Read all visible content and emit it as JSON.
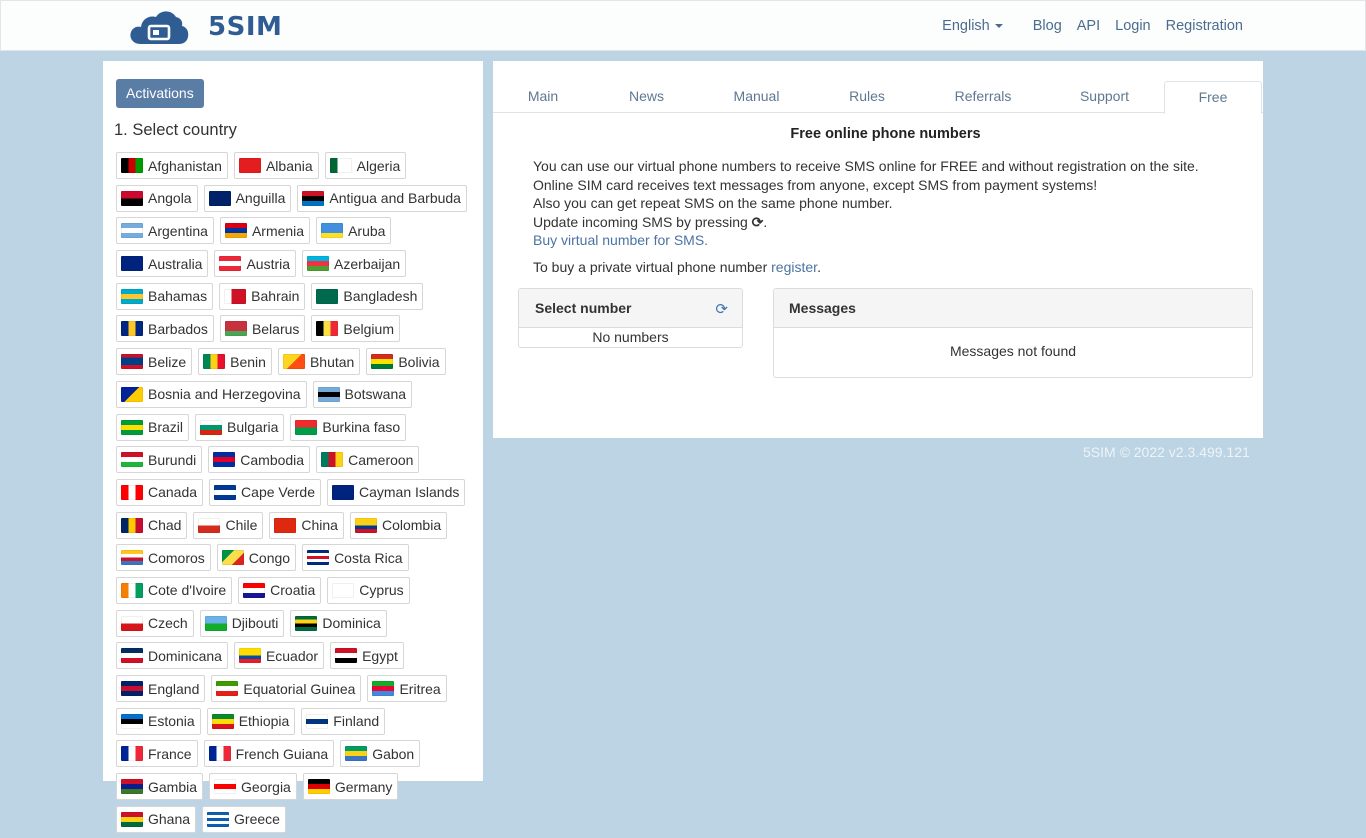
{
  "navbar": {
    "brand": "5SIM",
    "language": "English",
    "links": [
      "Blog",
      "API",
      "Login",
      "Registration"
    ]
  },
  "left": {
    "activations_button": "Activations",
    "select_title": "1. Select country",
    "countries": [
      {
        "name": "Afghanistan",
        "flag": [
          "#000",
          "#c00",
          "#090"
        ],
        "dir": "v"
      },
      {
        "name": "Albania",
        "flag": [
          "#e41e20",
          "#e41e20",
          "#e41e20"
        ],
        "dir": "v"
      },
      {
        "name": "Algeria",
        "flag": [
          "#006633",
          "#fff",
          "#fff"
        ],
        "dir": "v"
      },
      {
        "name": "Angola",
        "flag": [
          "#cc092f",
          "#000"
        ],
        "dir": "h"
      },
      {
        "name": "Anguilla",
        "flag": [
          "#012169",
          "#012169"
        ],
        "dir": "h"
      },
      {
        "name": "Antigua and Barbuda",
        "flag": [
          "#ce1126",
          "#000",
          "#0072c6"
        ],
        "dir": "h"
      },
      {
        "name": "Argentina",
        "flag": [
          "#74acdf",
          "#fff",
          "#74acdf"
        ],
        "dir": "h"
      },
      {
        "name": "Armenia",
        "flag": [
          "#d90012",
          "#0033a0",
          "#f2a800"
        ],
        "dir": "h"
      },
      {
        "name": "Aruba",
        "flag": [
          "#418fde",
          "#418fde",
          "#fbe122"
        ],
        "dir": "h"
      },
      {
        "name": "Australia",
        "flag": [
          "#00247d",
          "#00247d"
        ],
        "dir": "h"
      },
      {
        "name": "Austria",
        "flag": [
          "#ed2939",
          "#fff",
          "#ed2939"
        ],
        "dir": "h"
      },
      {
        "name": "Azerbaijan",
        "flag": [
          "#00b5e2",
          "#ef3340",
          "#509e2f"
        ],
        "dir": "h"
      },
      {
        "name": "Bahamas",
        "flag": [
          "#00abc9",
          "#ffc72c",
          "#00abc9"
        ],
        "dir": "h"
      },
      {
        "name": "Bahrain",
        "flag": [
          "#fff",
          "#ce1126",
          "#ce1126"
        ],
        "dir": "v"
      },
      {
        "name": "Bangladesh",
        "flag": [
          "#006a4e",
          "#006a4e"
        ],
        "dir": "h"
      },
      {
        "name": "Barbados",
        "flag": [
          "#00267f",
          "#ffc726",
          "#00267f"
        ],
        "dir": "v"
      },
      {
        "name": "Belarus",
        "flag": [
          "#c8313e",
          "#c8313e",
          "#4aa657"
        ],
        "dir": "h"
      },
      {
        "name": "Belgium",
        "flag": [
          "#000",
          "#fae042",
          "#ed2939"
        ],
        "dir": "v"
      },
      {
        "name": "Belize",
        "flag": [
          "#ce1126",
          "#003f87",
          "#003f87",
          "#ce1126"
        ],
        "dir": "h"
      },
      {
        "name": "Benin",
        "flag": [
          "#008751",
          "#fcd116",
          "#e8112d"
        ],
        "dir": "v"
      },
      {
        "name": "Bhutan",
        "flag": [
          "#ffd520",
          "#ff4e12"
        ],
        "dir": "d"
      },
      {
        "name": "Bolivia",
        "flag": [
          "#d52b1e",
          "#f9e300",
          "#007934"
        ],
        "dir": "h"
      },
      {
        "name": "Bosnia and Herzegovina",
        "flag": [
          "#002395",
          "#fecb00"
        ],
        "dir": "d"
      },
      {
        "name": "Botswana",
        "flag": [
          "#75aadb",
          "#000",
          "#75aadb"
        ],
        "dir": "h"
      },
      {
        "name": "Brazil",
        "flag": [
          "#009c3b",
          "#ffdf00",
          "#009c3b"
        ],
        "dir": "h"
      },
      {
        "name": "Bulgaria",
        "flag": [
          "#fff",
          "#00966e",
          "#d62612"
        ],
        "dir": "h"
      },
      {
        "name": "Burkina faso",
        "flag": [
          "#ef2b2d",
          "#009e49"
        ],
        "dir": "h"
      },
      {
        "name": "Burundi",
        "flag": [
          "#ce1126",
          "#fff",
          "#1eb53a"
        ],
        "dir": "h"
      },
      {
        "name": "Cambodia",
        "flag": [
          "#032ea1",
          "#e00025",
          "#032ea1"
        ],
        "dir": "h"
      },
      {
        "name": "Cameroon",
        "flag": [
          "#007a5e",
          "#ce1126",
          "#fcd116"
        ],
        "dir": "v"
      },
      {
        "name": "Canada",
        "flag": [
          "#ff0000",
          "#fff",
          "#ff0000"
        ],
        "dir": "v"
      },
      {
        "name": "Cape Verde",
        "flag": [
          "#003893",
          "#fff",
          "#003893"
        ],
        "dir": "h"
      },
      {
        "name": "Cayman Islands",
        "flag": [
          "#00247d",
          "#00247d"
        ],
        "dir": "h"
      },
      {
        "name": "Chad",
        "flag": [
          "#002664",
          "#fecb00",
          "#c60c30"
        ],
        "dir": "v"
      },
      {
        "name": "Chile",
        "flag": [
          "#fff",
          "#d52b1e"
        ],
        "dir": "h"
      },
      {
        "name": "China",
        "flag": [
          "#de2910",
          "#de2910"
        ],
        "dir": "h"
      },
      {
        "name": "Colombia",
        "flag": [
          "#fcd116",
          "#fcd116",
          "#003893",
          "#ce1126"
        ],
        "dir": "h"
      },
      {
        "name": "Comoros",
        "flag": [
          "#ffc61e",
          "#fff",
          "#ce1126",
          "#3a75c4"
        ],
        "dir": "h"
      },
      {
        "name": "Congo",
        "flag": [
          "#009543",
          "#fbde4a",
          "#dc241f"
        ],
        "dir": "d"
      },
      {
        "name": "Costa Rica",
        "flag": [
          "#002b7f",
          "#fff",
          "#ce1126",
          "#fff",
          "#002b7f"
        ],
        "dir": "h"
      },
      {
        "name": "Cote d'Ivoire",
        "flag": [
          "#f77f00",
          "#fff",
          "#009e60"
        ],
        "dir": "v"
      },
      {
        "name": "Croatia",
        "flag": [
          "#ff0000",
          "#fff",
          "#171796"
        ],
        "dir": "h"
      },
      {
        "name": "Cyprus",
        "flag": [
          "#fff",
          "#fff"
        ],
        "dir": "h"
      },
      {
        "name": "Czech",
        "flag": [
          "#fff",
          "#d7141a"
        ],
        "dir": "h"
      },
      {
        "name": "Djibouti",
        "flag": [
          "#6ab2e7",
          "#12ad2b"
        ],
        "dir": "h"
      },
      {
        "name": "Dominica",
        "flag": [
          "#006b3f",
          "#fcd116",
          "#000",
          "#006b3f"
        ],
        "dir": "h"
      },
      {
        "name": "Dominicana",
        "flag": [
          "#002d62",
          "#fff",
          "#ce1126"
        ],
        "dir": "h"
      },
      {
        "name": "Ecuador",
        "flag": [
          "#ffdd00",
          "#ffdd00",
          "#034ea2",
          "#ed1c24"
        ],
        "dir": "h"
      },
      {
        "name": "Egypt",
        "flag": [
          "#ce1126",
          "#fff",
          "#000"
        ],
        "dir": "h"
      },
      {
        "name": "England",
        "flag": [
          "#012169",
          "#c8102e",
          "#012169"
        ],
        "dir": "h"
      },
      {
        "name": "Equatorial Guinea",
        "flag": [
          "#3e9a00",
          "#fff",
          "#e32118"
        ],
        "dir": "h"
      },
      {
        "name": "Eritrea",
        "flag": [
          "#12ad2b",
          "#ea0437",
          "#4189dd"
        ],
        "dir": "h"
      },
      {
        "name": "Estonia",
        "flag": [
          "#0072ce",
          "#000",
          "#fff"
        ],
        "dir": "h"
      },
      {
        "name": "Ethiopia",
        "flag": [
          "#078930",
          "#fcdd09",
          "#da121a"
        ],
        "dir": "h"
      },
      {
        "name": "Finland",
        "flag": [
          "#fff",
          "#003580",
          "#fff"
        ],
        "dir": "h"
      },
      {
        "name": "France",
        "flag": [
          "#002395",
          "#fff",
          "#ed2939"
        ],
        "dir": "v"
      },
      {
        "name": "French Guiana",
        "flag": [
          "#002395",
          "#fff",
          "#ed2939"
        ],
        "dir": "v"
      },
      {
        "name": "Gabon",
        "flag": [
          "#009e60",
          "#fcd116",
          "#3a75c4"
        ],
        "dir": "h"
      },
      {
        "name": "Gambia",
        "flag": [
          "#ce1126",
          "#0c1c8c",
          "#3a7728"
        ],
        "dir": "h"
      },
      {
        "name": "Georgia",
        "flag": [
          "#fff",
          "#ff0000",
          "#fff"
        ],
        "dir": "h"
      },
      {
        "name": "Germany",
        "flag": [
          "#000",
          "#dd0000",
          "#ffce00"
        ],
        "dir": "h"
      },
      {
        "name": "Ghana",
        "flag": [
          "#ce1126",
          "#fcd116",
          "#006b3f"
        ],
        "dir": "h"
      },
      {
        "name": "Greece",
        "flag": [
          "#0d5eaf",
          "#fff",
          "#0d5eaf",
          "#fff",
          "#0d5eaf"
        ],
        "dir": "h"
      }
    ]
  },
  "main": {
    "tabs": [
      "Main",
      "News",
      "Manual",
      "Rules",
      "Referrals",
      "Support",
      "Free"
    ],
    "active_tab": "Free",
    "title": "Free online phone numbers",
    "lines": [
      "You can use our virtual phone numbers to receive SMS online for FREE and without registration on the site.",
      "Online SIM card receives text messages from anyone, except SMS from payment systems!",
      "Also you can get repeat SMS on the same phone number."
    ],
    "update_text": "Update incoming SMS by pressing",
    "buy_link": "Buy virtual number for SMS.",
    "register_prefix": "To buy a private virtual phone number",
    "register_link": "register",
    "select_number": {
      "title": "Select number",
      "empty": "No numbers"
    },
    "messages": {
      "title": "Messages",
      "empty": "Messages not found"
    }
  },
  "footer": "5SIM © 2022 v2.3.499.121"
}
